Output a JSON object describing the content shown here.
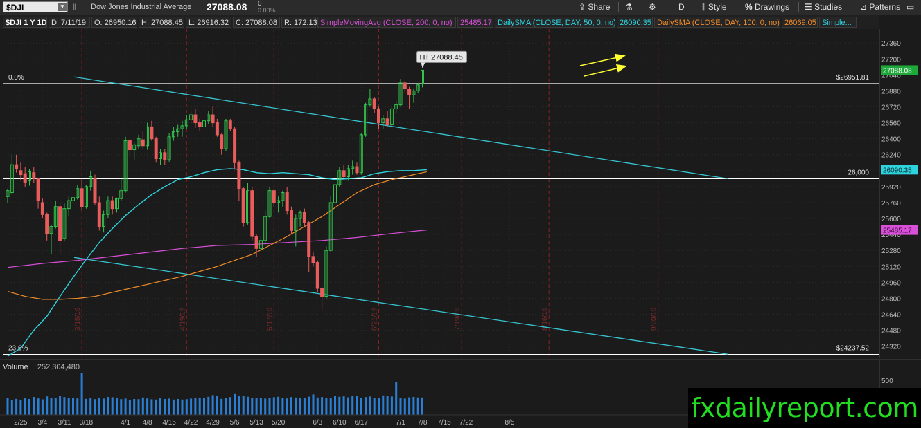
{
  "toolbar": {
    "symbol": "$DJI",
    "description": "Dow Jones Industrial Average",
    "last": "27088.08",
    "change": "0",
    "change_pct": "0.00%",
    "buttons": {
      "share": "Share",
      "timeframe": "D",
      "style": "Style",
      "drawings": "Drawings",
      "studies": "Studies",
      "patterns": "Patterns"
    }
  },
  "infobar": {
    "chart_label": "$DJI 1 Y 1D",
    "date": "D: 7/11/19",
    "open": "O: 26950.16",
    "high": "H: 27088.45",
    "low": "L: 26916.32",
    "close": "C: 27088.08",
    "range": "R: 172.13",
    "sma200_label": "SimpleMovingAvg (CLOSE, 200, 0, no)",
    "sma200_value": "25485.17",
    "sma50_label": "DailySMA (CLOSE, DAY, 50, 0, no)",
    "sma50_value": "26090.35",
    "sma100_label": "DailySMA (CLOSE, DAY, 100, 0, no)",
    "sma100_value": "26069.05",
    "more_label": "Simple..."
  },
  "colors": {
    "up": "#33c24d",
    "down": "#e85c5c",
    "sma50": "#2ed3de",
    "sma100": "#f28c28",
    "sma200": "#d94fd9",
    "trendline": "#36c5d1",
    "level": "#ffffff",
    "event_line": "#8a1f1f",
    "volume": "#2a7fd4",
    "arrow": "#ffff33"
  },
  "volume": {
    "label": "Volume",
    "value": "252,304,480",
    "axis_label": "500"
  },
  "watermark": "fxdailyreport.com",
  "chart_data": {
    "type": "candlestick",
    "ylim": [
      24200,
      27500
    ],
    "y_ticks": [
      24320,
      24480,
      24640,
      24800,
      24960,
      25120,
      25280,
      25440,
      25600,
      25760,
      25920,
      26080,
      26240,
      26400,
      26560,
      26720,
      26880,
      27040,
      27200,
      27360
    ],
    "x_ticks": [
      "2/25",
      "3/4",
      "3/11",
      "3/18",
      "4/1",
      "4/8",
      "4/15",
      "4/22",
      "4/29",
      "5/6",
      "5/13",
      "5/20",
      "6/3",
      "6/10",
      "6/17",
      "7/1",
      "7/8",
      "7/15",
      "7/22",
      "8/5"
    ],
    "x_tick_index": [
      3,
      8,
      13,
      18,
      27,
      32,
      37,
      42,
      47,
      52,
      57,
      62,
      71,
      76,
      81,
      90,
      95,
      100,
      105,
      115
    ],
    "event_dates": [
      "3/15/19",
      "4/19/19",
      "5/17/19",
      "6/21/19",
      "7/19/19",
      "8/16/19",
      "9/20/19"
    ],
    "event_index": [
      17,
      41,
      61,
      85,
      104,
      124,
      149
    ],
    "last_price": "27088.08",
    "high_label": "Hi: 27088.45",
    "levels": [
      {
        "value": 26951.81,
        "left_label": "0.0%",
        "right_label": "$26951.81"
      },
      {
        "value": 26000,
        "left_label": "",
        "right_label": "26,000"
      },
      {
        "value": 24237.52,
        "left_label": "23.6%",
        "right_label": "$24237.52"
      }
    ],
    "right_badges": [
      {
        "value": 26090.35,
        "label": "26090.35"
      },
      {
        "value": 25485.17,
        "label": "25485.17"
      }
    ],
    "trendlines": [
      {
        "x1": 0,
        "y1": 27020,
        "x2": 131,
        "y2": 26000
      },
      {
        "x1": 0,
        "y1": 25210,
        "x2": 131,
        "y2": 24240
      }
    ],
    "ohlc": [
      [
        25820,
        25900,
        25760,
        25880
      ],
      [
        25860,
        26240,
        25840,
        26140
      ],
      [
        26140,
        26240,
        26060,
        26100
      ],
      [
        26080,
        26160,
        25980,
        26040
      ],
      [
        26050,
        26120,
        25920,
        25960
      ],
      [
        25980,
        26100,
        25930,
        26070
      ],
      [
        26060,
        26120,
        25960,
        26000
      ],
      [
        26000,
        26010,
        25700,
        25780
      ],
      [
        25760,
        25800,
        25600,
        25640
      ],
      [
        25640,
        25660,
        25380,
        25450
      ],
      [
        25450,
        25540,
        25240,
        25520
      ],
      [
        25520,
        25780,
        25500,
        25720
      ],
      [
        25720,
        25760,
        25240,
        25380
      ],
      [
        25400,
        25750,
        25380,
        25700
      ],
      [
        25700,
        25820,
        25620,
        25780
      ],
      [
        25780,
        25840,
        25700,
        25810
      ],
      [
        25810,
        25940,
        25790,
        25900
      ],
      [
        25900,
        26000,
        25680,
        25720
      ],
      [
        25720,
        25940,
        25700,
        25920
      ],
      [
        25920,
        26080,
        25880,
        26020
      ],
      [
        26000,
        26040,
        25740,
        25760
      ],
      [
        25760,
        25820,
        25480,
        25520
      ],
      [
        25520,
        25680,
        25460,
        25640
      ],
      [
        25640,
        25820,
        25600,
        25780
      ],
      [
        25780,
        25820,
        25640,
        25700
      ],
      [
        25700,
        25810,
        25660,
        25800
      ],
      [
        25800,
        26000,
        25780,
        25880
      ],
      [
        25880,
        26420,
        25860,
        26380
      ],
      [
        26380,
        26400,
        26220,
        26290
      ],
      [
        26290,
        26360,
        26180,
        26340
      ],
      [
        26330,
        26440,
        26300,
        26400
      ],
      [
        26390,
        26480,
        26300,
        26330
      ],
      [
        26330,
        26560,
        26290,
        26520
      ],
      [
        26520,
        26580,
        26380,
        26400
      ],
      [
        26400,
        26420,
        26160,
        26200
      ],
      [
        26200,
        26300,
        26140,
        26260
      ],
      [
        26260,
        26300,
        26140,
        26190
      ],
      [
        26190,
        26460,
        26170,
        26420
      ],
      [
        26420,
        26520,
        26380,
        26470
      ],
      [
        26470,
        26540,
        26420,
        26500
      ],
      [
        26500,
        26580,
        26420,
        26530
      ],
      [
        26530,
        26640,
        26500,
        26590
      ],
      [
        26590,
        26690,
        26560,
        26640
      ],
      [
        26640,
        26700,
        26510,
        26560
      ],
      [
        26560,
        26600,
        26480,
        26520
      ],
      [
        26520,
        26600,
        26500,
        26580
      ],
      [
        26580,
        26680,
        26550,
        26640
      ],
      [
        26640,
        26720,
        26520,
        26560
      ],
      [
        26560,
        26600,
        26420,
        26440
      ],
      [
        26440,
        26460,
        26240,
        26300
      ],
      [
        26300,
        26600,
        26280,
        26580
      ],
      [
        26580,
        26600,
        26480,
        26500
      ],
      [
        26500,
        26520,
        26100,
        26160
      ],
      [
        26160,
        26180,
        25780,
        25900
      ],
      [
        25900,
        25920,
        25520,
        25560
      ],
      [
        25560,
        25960,
        25540,
        25880
      ],
      [
        25880,
        25920,
        25380,
        25420
      ],
      [
        25420,
        25440,
        25220,
        25300
      ],
      [
        25300,
        25420,
        25260,
        25380
      ],
      [
        25380,
        25680,
        25340,
        25620
      ],
      [
        25620,
        25920,
        25600,
        25880
      ],
      [
        25880,
        25900,
        25720,
        25760
      ],
      [
        25760,
        25820,
        25660,
        25780
      ],
      [
        25780,
        25880,
        25720,
        25860
      ],
      [
        25860,
        25920,
        25640,
        25680
      ],
      [
        25680,
        25720,
        25440,
        25480
      ],
      [
        25480,
        25640,
        25320,
        25600
      ],
      [
        25600,
        25680,
        25520,
        25660
      ],
      [
        25660,
        25700,
        25520,
        25560
      ],
      [
        25560,
        25580,
        25060,
        25220
      ],
      [
        25220,
        25260,
        25120,
        25160
      ],
      [
        25160,
        25180,
        24860,
        24900
      ],
      [
        24900,
        24920,
        24680,
        24820
      ],
      [
        24820,
        25320,
        24800,
        25280
      ],
      [
        25280,
        25820,
        25260,
        25760
      ],
      [
        25760,
        25980,
        25700,
        25940
      ],
      [
        25940,
        26120,
        25920,
        26080
      ],
      [
        26080,
        26140,
        26000,
        26020
      ],
      [
        26020,
        26140,
        25980,
        26100
      ],
      [
        26100,
        26180,
        26040,
        26120
      ],
      [
        26120,
        26160,
        26040,
        26060
      ],
      [
        26060,
        26460,
        26040,
        26440
      ],
      [
        26440,
        26760,
        26420,
        26740
      ],
      [
        26740,
        26900,
        26720,
        26800
      ],
      [
        26800,
        26820,
        26660,
        26700
      ],
      [
        26700,
        26720,
        26500,
        26560
      ],
      [
        26560,
        26640,
        26500,
        26600
      ],
      [
        26600,
        26680,
        26520,
        26540
      ],
      [
        26540,
        26720,
        26520,
        26700
      ],
      [
        26700,
        26780,
        26660,
        26740
      ],
      [
        26740,
        27000,
        26720,
        26960
      ],
      [
        26960,
        26980,
        26860,
        26900
      ],
      [
        26900,
        26920,
        26700,
        26840
      ],
      [
        26840,
        26900,
        26760,
        26880
      ],
      [
        26880,
        26960,
        26860,
        26940
      ],
      [
        26950,
        27088,
        26916,
        27088
      ]
    ],
    "sma50": [
      [
        0,
        24220
      ],
      [
        3,
        24300
      ],
      [
        6,
        24480
      ],
      [
        9,
        24620
      ],
      [
        12,
        24820
      ],
      [
        15,
        25010
      ],
      [
        18,
        25190
      ],
      [
        21,
        25360
      ],
      [
        24,
        25500
      ],
      [
        27,
        25630
      ],
      [
        30,
        25740
      ],
      [
        33,
        25840
      ],
      [
        36,
        25920
      ],
      [
        39,
        25990
      ],
      [
        42,
        26020
      ],
      [
        45,
        26060
      ],
      [
        48,
        26090
      ],
      [
        51,
        26100
      ],
      [
        54,
        26090
      ],
      [
        57,
        26060
      ],
      [
        60,
        26050
      ],
      [
        63,
        26060
      ],
      [
        66,
        26050
      ],
      [
        69,
        26040
      ],
      [
        72,
        26010
      ],
      [
        75,
        25990
      ],
      [
        78,
        26000
      ],
      [
        81,
        26010
      ],
      [
        84,
        26050
      ],
      [
        87,
        26070
      ],
      [
        90,
        26080
      ],
      [
        93,
        26080
      ],
      [
        96,
        26090
      ]
    ],
    "sma100": [
      [
        0,
        24870
      ],
      [
        4,
        24820
      ],
      [
        8,
        24790
      ],
      [
        12,
        24790
      ],
      [
        16,
        24800
      ],
      [
        20,
        24820
      ],
      [
        24,
        24860
      ],
      [
        28,
        24900
      ],
      [
        32,
        24940
      ],
      [
        36,
        24980
      ],
      [
        40,
        25020
      ],
      [
        44,
        25070
      ],
      [
        48,
        25120
      ],
      [
        52,
        25180
      ],
      [
        56,
        25240
      ],
      [
        60,
        25330
      ],
      [
        64,
        25420
      ],
      [
        68,
        25520
      ],
      [
        72,
        25620
      ],
      [
        76,
        25740
      ],
      [
        80,
        25860
      ],
      [
        84,
        25940
      ],
      [
        88,
        25990
      ],
      [
        92,
        26030
      ],
      [
        96,
        26069
      ]
    ],
    "sma200": [
      [
        0,
        25110
      ],
      [
        8,
        25150
      ],
      [
        16,
        25180
      ],
      [
        24,
        25220
      ],
      [
        32,
        25260
      ],
      [
        40,
        25300
      ],
      [
        48,
        25330
      ],
      [
        56,
        25340
      ],
      [
        64,
        25360
      ],
      [
        72,
        25380
      ],
      [
        80,
        25410
      ],
      [
        88,
        25450
      ],
      [
        96,
        25485
      ]
    ],
    "volume": [
      245,
      210,
      232,
      220,
      250,
      230,
      260,
      238,
      225,
      268,
      248,
      240,
      270,
      258,
      250,
      240,
      238,
      600,
      232,
      240,
      228,
      248,
      236,
      260,
      256,
      240,
      228,
      236,
      220,
      230,
      228,
      252,
      238,
      226,
      222,
      248,
      230,
      236,
      222,
      230,
      222,
      228,
      236,
      240,
      244,
      248,
      262,
      286,
      272,
      232,
      246,
      258,
      302,
      270,
      280,
      262,
      250,
      246,
      240,
      236,
      248,
      256,
      262,
      240,
      238,
      258,
      252,
      244,
      250,
      264,
      296,
      252,
      258,
      244,
      240,
      270,
      262,
      268,
      254,
      276,
      280,
      250,
      258,
      266,
      250,
      246,
      282,
      272,
      266,
      470,
      240,
      236,
      254,
      260,
      252,
      252
    ]
  }
}
